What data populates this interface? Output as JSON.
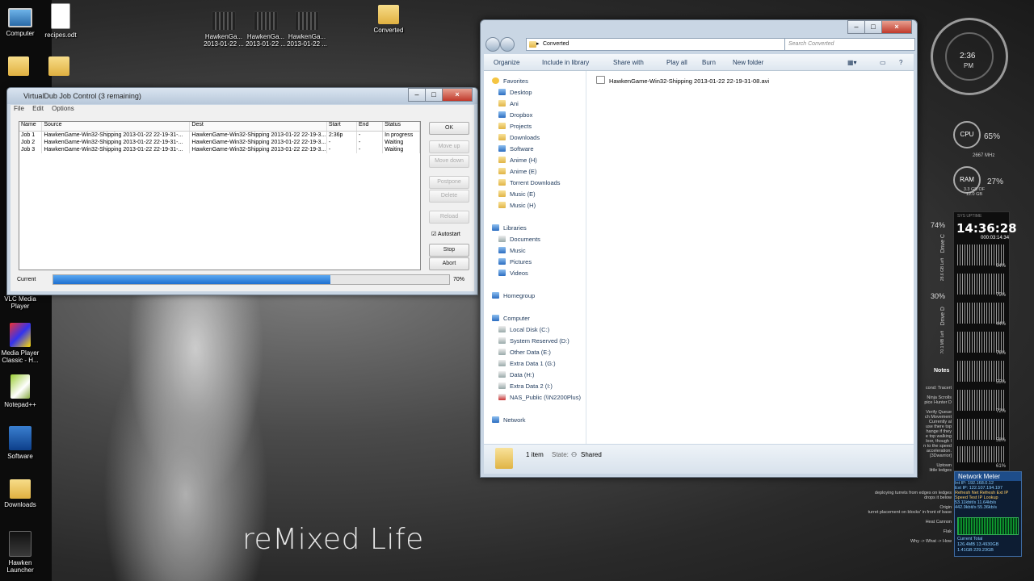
{
  "desktop": {
    "icons_top": [
      {
        "label": "Computer"
      },
      {
        "label": "recipes.odt"
      },
      {
        "label": "HawkenGa... 2013-01-22 ..."
      },
      {
        "label": "HawkenGa... 2013-01-22 ..."
      },
      {
        "label": "HawkenGa... 2013-01-22 ..."
      },
      {
        "label": "Converted"
      }
    ],
    "icons_left": [
      {
        "label": "VLC Media Player"
      },
      {
        "label": "Media Player Classic - H..."
      },
      {
        "label": "Notepad++"
      },
      {
        "label": "Software"
      },
      {
        "label": "Downloads"
      },
      {
        "label": "Hawken Launcher"
      }
    ],
    "wallpaper_text": "reMixed Life"
  },
  "vdub": {
    "title": "VirtualDub Job Control (3 remaining)",
    "menu": [
      "File",
      "Edit",
      "Options"
    ],
    "columns": [
      "Name",
      "Source",
      "Dest",
      "Start",
      "End",
      "Status"
    ],
    "jobs": [
      {
        "name": "Job 1",
        "source": "HawkenGame-Win32-Shipping 2013-01-22 22-19-31-...",
        "dest": "HawkenGame-Win32-Shipping 2013-01-22 22-19-3...",
        "start": "2:36p",
        "end": "-",
        "status": "In progress"
      },
      {
        "name": "Job 2",
        "source": "HawkenGame-Win32-Shipping 2013-01-22 22-19-31-...",
        "dest": "HawkenGame-Win32-Shipping 2013-01-22 22-19-3...",
        "start": "-",
        "end": "-",
        "status": "Waiting"
      },
      {
        "name": "Job 3",
        "source": "HawkenGame-Win32-Shipping 2013-01-22 22-19-31-...",
        "dest": "HawkenGame-Win32-Shipping 2013-01-22 22-19-3...",
        "start": "-",
        "end": "-",
        "status": "Waiting"
      }
    ],
    "buttons": {
      "ok": "OK",
      "move_up": "Move up",
      "move_down": "Move down",
      "postpone": "Postpone",
      "delete": "Delete",
      "reload": "Reload",
      "stop": "Stop",
      "abort": "Abort"
    },
    "autostart_label": "Autostart",
    "current_label": "Current",
    "progress_value": 70,
    "progress_text": "70%"
  },
  "explorer": {
    "breadcrumb": "Converted",
    "search_placeholder": "Search Converted",
    "toolbar": {
      "organize": "Organize",
      "include": "Include in library",
      "share": "Share with",
      "play_all": "Play all",
      "burn": "Burn",
      "new_folder": "New folder"
    },
    "nav": {
      "favorites": "Favorites",
      "fav_items": [
        "Desktop",
        "Ani",
        "Dropbox",
        "Projects",
        "Downloads",
        "Software",
        "Anime (H)",
        "Anime (E)",
        "Torrent Downloads",
        "Music (E)",
        "Music (H)"
      ],
      "libraries": "Libraries",
      "lib_items": [
        "Documents",
        "Music",
        "Pictures",
        "Videos"
      ],
      "homegroup": "Homegroup",
      "computer": "Computer",
      "comp_items": [
        "Local Disk (C:)",
        "System Reserved (D:)",
        "Other Data (E:)",
        "Extra Data 1 (G:)",
        "Data (H:)",
        "Extra Data 2 (I:)",
        "NAS_Public (\\\\N2200Plus)"
      ],
      "network": "Network"
    },
    "files": [
      "HawkenGame-Win32-Shipping 2013-01-22 22-19-31-08.avi"
    ],
    "status": {
      "count": "1 item",
      "state_label": "State:",
      "state_value": "Shared"
    }
  },
  "gadgets": {
    "clock_time": "2:36",
    "clock_ampm": "PM",
    "cpu_label": "CPU",
    "cpu_pct": "65%",
    "cpu_freq": "2667 MHz",
    "ram_label": "RAM",
    "ram_pct": "27%",
    "ram_detail": "3.3 GB OF 12.0 GB",
    "sys_label": "SYS UPTIME",
    "big_clock": "14:36:28",
    "uptime": "000:03:14:34",
    "drive_c_pct": "74%",
    "drive_c_label": "Drive C",
    "drive_c_left": "28.6 GB Left",
    "drive_d_pct": "30%",
    "drive_d_label": "Drive D",
    "drive_d_left": "70.1 MB Left",
    "core_pcts": [
      "64%",
      "75%",
      "44%",
      "76%",
      "55%",
      "72%",
      "58%",
      "61%"
    ],
    "notes_title": "Notes",
    "notes": [
      "cond: Tracert",
      "Ninja Scrolls",
      "pice Hunter D",
      "Verify Queue",
      "ch Movement",
      "Currently al",
      "use there top",
      "hange if they",
      "e top walking",
      "loor, though I",
      "n to the speed",
      "acceleration.",
      "[3Dwarrior]",
      "Uptown",
      "little ledges",
      "deploying turrets from edges on ledges",
      "drops it below",
      "Origin",
      "turret placement on blocks' in front of base",
      "Heat Cannon",
      "Flak",
      "Why -> What -> How"
    ],
    "net": {
      "title": "Network Meter",
      "int_ip": "Int IP: 192.168.0.12",
      "ext_ip": "Ext IP: 122.107.194.197",
      "refresh": "Refresh Net  Refresh Ext IP",
      "speed": "Speed Test  IP Lookup",
      "up": "53.11kbit/s  11.64kb/s",
      "down": "442.9kbit/s  55.36kb/s",
      "current_total": "Current  Total",
      "cur_up": "126.4MB  13.4930GB",
      "cur_down": "1.41GB  229.23GB"
    }
  }
}
